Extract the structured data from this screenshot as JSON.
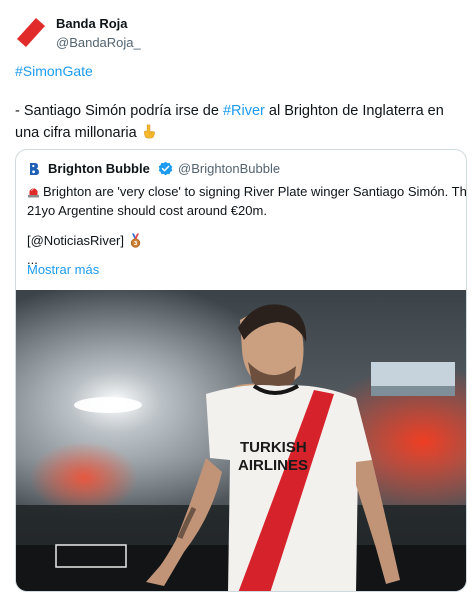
{
  "tweet": {
    "author": {
      "name": "Banda Roja",
      "handle": "@BandaRoja_"
    },
    "hashtag": "#SimonGate",
    "body": {
      "part1": "- Santiago Simón podría irse de ",
      "hashtag_river": "#River",
      "part2": " al Brighton de Inglaterra en una cifra millonaria"
    },
    "emoji": "backhand-index-pointing-down"
  },
  "quote": {
    "author": {
      "name": "Brighton Bubble",
      "handle": "@BrightonBubble",
      "separator": "·",
      "verified": true
    },
    "lines": [
      "Brighton are 'very close' to signing River Plate winger Santiago Simón. The",
      "21yo Argentine should cost around €20m."
    ],
    "credit": "[@NoticiasRiver]",
    "ellipsis": "...",
    "show_more": "Mostrar más",
    "jersey_text": {
      "line1": "TURKISH",
      "line2": "AIRLINES"
    }
  },
  "colors": {
    "link": "#1d9bf0",
    "secondary_text": "#536471",
    "border": "#cfd9de",
    "river_red": "#d6222a"
  }
}
